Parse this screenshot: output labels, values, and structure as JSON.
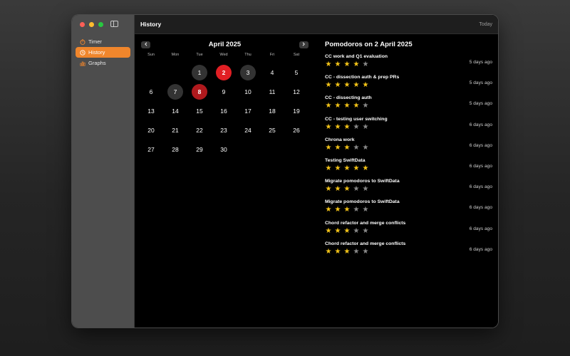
{
  "sidebar": {
    "items": [
      {
        "label": "Timer",
        "icon": "timer-icon",
        "selected": false
      },
      {
        "label": "History",
        "icon": "history-icon",
        "selected": true
      },
      {
        "label": "Graphs",
        "icon": "graphs-icon",
        "selected": false
      }
    ]
  },
  "window": {
    "title": "History",
    "today_label": "Today"
  },
  "calendar": {
    "month_title": "April 2025",
    "weekdays": [
      "Sun",
      "Mon",
      "Tue",
      "Wed",
      "Thu",
      "Fri",
      "Sat"
    ],
    "leading_blanks": 2,
    "days": [
      {
        "n": "1",
        "state": "has"
      },
      {
        "n": "2",
        "state": "rated"
      },
      {
        "n": "3",
        "state": "has"
      },
      {
        "n": "4",
        "state": ""
      },
      {
        "n": "5",
        "state": ""
      },
      {
        "n": "6",
        "state": ""
      },
      {
        "n": "7",
        "state": "has"
      },
      {
        "n": "8",
        "state": "today"
      },
      {
        "n": "9",
        "state": ""
      },
      {
        "n": "10",
        "state": ""
      },
      {
        "n": "11",
        "state": ""
      },
      {
        "n": "12",
        "state": ""
      },
      {
        "n": "13",
        "state": ""
      },
      {
        "n": "14",
        "state": ""
      },
      {
        "n": "15",
        "state": ""
      },
      {
        "n": "16",
        "state": ""
      },
      {
        "n": "17",
        "state": ""
      },
      {
        "n": "18",
        "state": ""
      },
      {
        "n": "19",
        "state": ""
      },
      {
        "n": "20",
        "state": ""
      },
      {
        "n": "21",
        "state": ""
      },
      {
        "n": "22",
        "state": ""
      },
      {
        "n": "23",
        "state": ""
      },
      {
        "n": "24",
        "state": ""
      },
      {
        "n": "25",
        "state": ""
      },
      {
        "n": "26",
        "state": ""
      },
      {
        "n": "27",
        "state": ""
      },
      {
        "n": "28",
        "state": ""
      },
      {
        "n": "29",
        "state": ""
      },
      {
        "n": "30",
        "state": ""
      }
    ],
    "colors": {
      "rated": "#e11f24",
      "today": "#b0191d",
      "has": "#333333"
    }
  },
  "pomodoros": {
    "title": "Pomodoros on 2 April 2025",
    "items": [
      {
        "name": "CC work and Q1 evaluation",
        "rating": 4,
        "ago": "5 days ago"
      },
      {
        "name": "CC - dissection auth & prep PRs",
        "rating": 5,
        "ago": "5 days ago"
      },
      {
        "name": "CC - dissecting auth",
        "rating": 4,
        "ago": "5 days ago"
      },
      {
        "name": "CC - testing user switching",
        "rating": 3,
        "ago": "6 days ago"
      },
      {
        "name": "Chrona work",
        "rating": 3,
        "ago": "6 days ago"
      },
      {
        "name": "Testing SwiftData",
        "rating": 5,
        "ago": "6 days ago"
      },
      {
        "name": "Migrate pomodoros to SwiftData",
        "rating": 3,
        "ago": "6 days ago"
      },
      {
        "name": "Migrate pomodoros to SwiftData",
        "rating": 3,
        "ago": "6 days ago"
      },
      {
        "name": "Chord refactor and merge conflicts",
        "rating": 3,
        "ago": "6 days ago"
      },
      {
        "name": "Chord refactor and merge conflicts",
        "rating": 3,
        "ago": "6 days ago"
      }
    ],
    "max_rating": 5,
    "star_color": "#f5c518"
  }
}
